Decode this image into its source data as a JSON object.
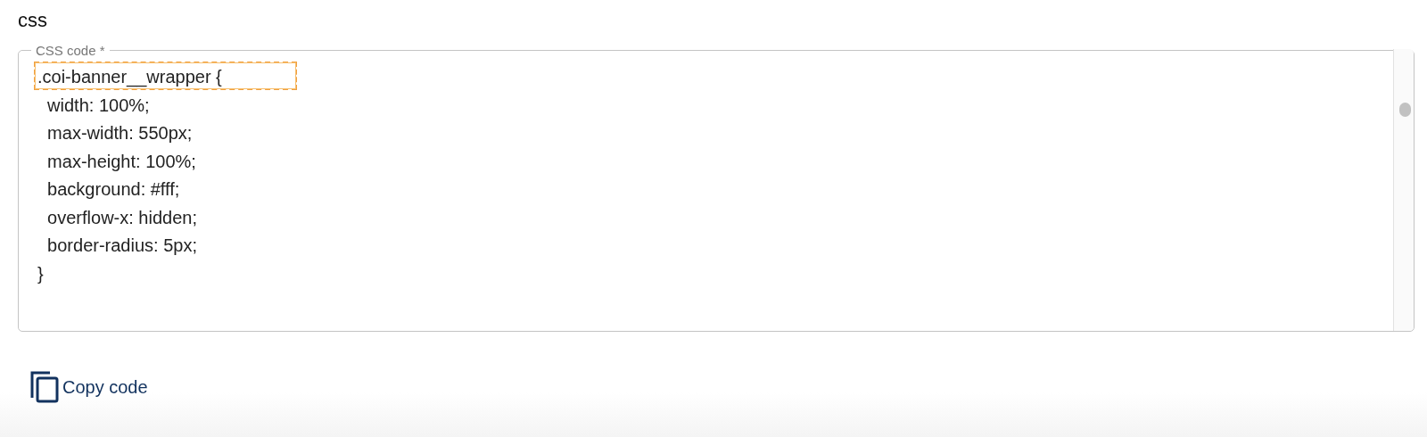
{
  "section_title": "css",
  "code_field": {
    "label": "CSS code *",
    "lines": [
      {
        "text": ".coi-banner__wrapper {",
        "highlighted": true
      },
      {
        "text": "  width: 100%;",
        "highlighted": false
      },
      {
        "text": "  max-width: 550px;",
        "highlighted": false
      },
      {
        "text": "  max-height: 100%;",
        "highlighted": false
      },
      {
        "text": "  background: #fff;",
        "highlighted": false
      },
      {
        "text": "  overflow-x: hidden;",
        "highlighted": false
      },
      {
        "text": "  border-radius: 5px;",
        "highlighted": false
      },
      {
        "text": "}",
        "highlighted": false
      }
    ]
  },
  "copy_button": {
    "label": "Copy code"
  }
}
